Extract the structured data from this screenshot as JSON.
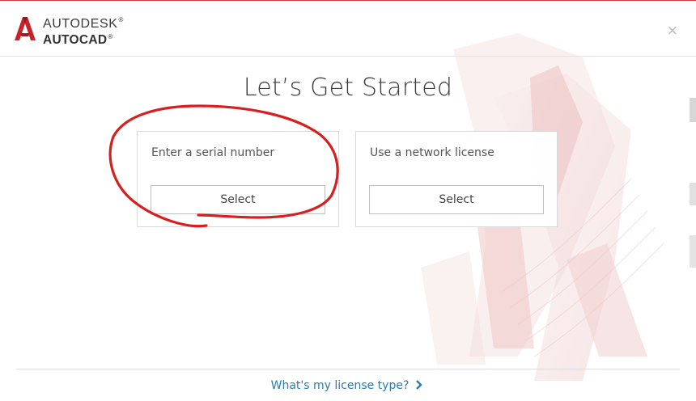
{
  "window": {
    "brand_company": "AUTODESK",
    "brand_product": "AUTOCAD",
    "close_glyph": "×"
  },
  "main": {
    "title": "Let’s Get Started",
    "options": [
      {
        "label": "Enter a serial number",
        "button_label": "Select"
      },
      {
        "label": "Use a network license",
        "button_label": "Select"
      }
    ]
  },
  "footer": {
    "link_text": "What's my license type?",
    "link_icon": "chevron-right-icon"
  },
  "icons": {
    "logo": "autocad-logo-icon",
    "close": "close-icon"
  },
  "colors": {
    "accent_red": "#d33a3a",
    "link_blue": "#2a7ab3",
    "annotation_red": "#d81f1f"
  }
}
